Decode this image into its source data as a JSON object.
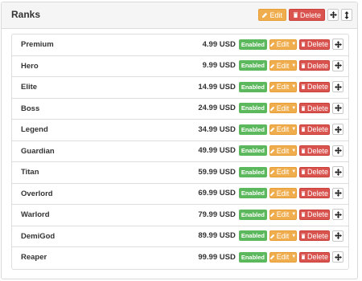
{
  "panel": {
    "title": "Ranks",
    "edit_label": "Edit",
    "delete_label": "Delete"
  },
  "icons": {
    "edit": "pencil-icon",
    "delete": "trash-icon",
    "move": "arrows-move-icon",
    "reorder": "arrows-vertical-icon"
  },
  "colors": {
    "warning": "#f0ad4e",
    "danger": "#d9534f",
    "success": "#5cb85c"
  },
  "ranks": [
    {
      "name": "Premium",
      "price": "4.99 USD",
      "status": "Enabled",
      "edit_label": "Edit",
      "delete_label": "Delete"
    },
    {
      "name": "Hero",
      "price": "9.99 USD",
      "status": "Enabled",
      "edit_label": "Edit",
      "delete_label": "Delete"
    },
    {
      "name": "Elite",
      "price": "14.99 USD",
      "status": "Enabled",
      "edit_label": "Edit",
      "delete_label": "Delete"
    },
    {
      "name": "Boss",
      "price": "24.99 USD",
      "status": "Enabled",
      "edit_label": "Edit",
      "delete_label": "Delete"
    },
    {
      "name": "Legend",
      "price": "34.99 USD",
      "status": "Enabled",
      "edit_label": "Edit",
      "delete_label": "Delete"
    },
    {
      "name": "Guardian",
      "price": "49.99 USD",
      "status": "Enabled",
      "edit_label": "Edit",
      "delete_label": "Delete"
    },
    {
      "name": "Titan",
      "price": "59.99 USD",
      "status": "Enabled",
      "edit_label": "Edit",
      "delete_label": "Delete"
    },
    {
      "name": "Overlord",
      "price": "69.99 USD",
      "status": "Enabled",
      "edit_label": "Edit",
      "delete_label": "Delete"
    },
    {
      "name": "Warlord",
      "price": "79.99 USD",
      "status": "Enabled",
      "edit_label": "Edit",
      "delete_label": "Delete"
    },
    {
      "name": "DemiGod",
      "price": "89.99 USD",
      "status": "Enabled",
      "edit_label": "Edit",
      "delete_label": "Delete"
    },
    {
      "name": "Reaper",
      "price": "99.99 USD",
      "status": "Enabled",
      "edit_label": "Edit",
      "delete_label": "Delete"
    }
  ]
}
